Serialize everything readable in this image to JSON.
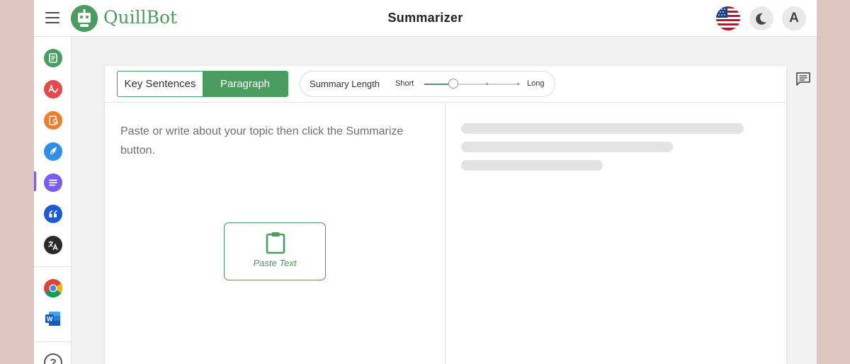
{
  "header": {
    "brand": "QuillBot",
    "title": "Summarizer",
    "avatar_initial": "A"
  },
  "sidebar": {
    "items": [
      {
        "name": "paraphraser",
        "icon": "document-lines-icon",
        "color": "#4a9c5f"
      },
      {
        "name": "grammar-checker",
        "icon": "spell-check-icon",
        "color": "#e5484d"
      },
      {
        "name": "plagiarism-checker",
        "icon": "document-search-icon",
        "color": "#f07d2a"
      },
      {
        "name": "co-writer",
        "icon": "feather-icon",
        "color": "#2f8fe6"
      },
      {
        "name": "summarizer",
        "icon": "lines-icon",
        "color": "#7b5cf0",
        "active": true
      },
      {
        "name": "citation-generator",
        "icon": "quote-icon",
        "color": "#1f5ad6"
      },
      {
        "name": "translator",
        "icon": "translate-icon",
        "color": "#2a2a2a"
      },
      {
        "name": "chrome-extension",
        "icon": "chrome-icon",
        "color": "#db4437"
      },
      {
        "name": "word-add-in",
        "icon": "word-icon",
        "color": "#185abd"
      },
      {
        "name": "help",
        "icon": "help-icon",
        "color": "#555555"
      }
    ]
  },
  "toolbar": {
    "mode_key_sentences": "Key Sentences",
    "mode_paragraph": "Paragraph",
    "active_mode": "Paragraph",
    "summary_length_label": "Summary Length",
    "short_label": "Short",
    "long_label": "Long",
    "summary_length_value": 0.3
  },
  "editor": {
    "placeholder": "Paste or write about your topic then click the Summarize button.",
    "paste_label": "Paste Text"
  },
  "colors": {
    "accent": "#4a9c5f",
    "background": "#f2f2f2",
    "outer": "#dcc6bf"
  }
}
